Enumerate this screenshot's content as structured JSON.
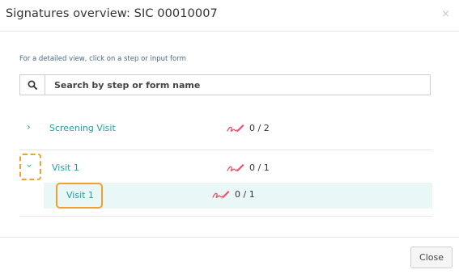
{
  "dialog": {
    "title": "Signatures overview: SIC 00010007",
    "close_icon": "×"
  },
  "hint": "For a detailed view, click on a step or input form",
  "search": {
    "placeholder": "Search by step or form name",
    "icon": "search-icon"
  },
  "tree": [
    {
      "label": "Screening Visit",
      "expanded": false,
      "count": "0 / 2"
    },
    {
      "label": "Visit 1",
      "expanded": true,
      "count": "0 / 1",
      "children": [
        {
          "label": "Visit 1",
          "count": "0 / 1"
        }
      ]
    }
  ],
  "footer": {
    "close_label": "Close"
  },
  "colors": {
    "accent": "#1e9fa0",
    "signature_icon": "#e8506a",
    "highlight_box": "#f0a030",
    "selected_row_bg": "#eaf7f7"
  }
}
